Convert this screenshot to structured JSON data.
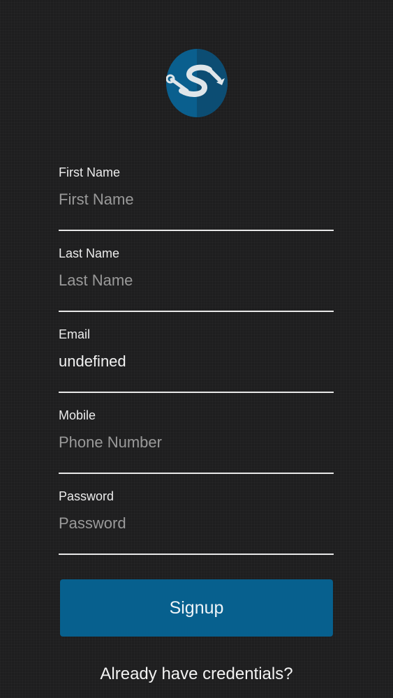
{
  "logo": {
    "icon": "wrench-s-logo-icon",
    "colors": {
      "circle": "#0a5f8e",
      "shade": "#0c4b70",
      "mark": "#dfe6ea"
    }
  },
  "form": {
    "fields": [
      {
        "label": "First Name",
        "value": "",
        "placeholder": "First Name"
      },
      {
        "label": "Last Name",
        "value": "",
        "placeholder": "Last Name"
      },
      {
        "label": "Email",
        "value": "undefined",
        "placeholder": ""
      },
      {
        "label": "Mobile",
        "value": "",
        "placeholder": "Phone Number"
      },
      {
        "label": "Password",
        "value": "",
        "placeholder": "Password"
      }
    ]
  },
  "actions": {
    "signup_label": "Signup",
    "login_link": "Already have credentials?"
  },
  "colors": {
    "background": "#1e1e1f",
    "accent": "#07608e",
    "text": "#f2f2f2",
    "placeholder": "#9a9a9a"
  }
}
